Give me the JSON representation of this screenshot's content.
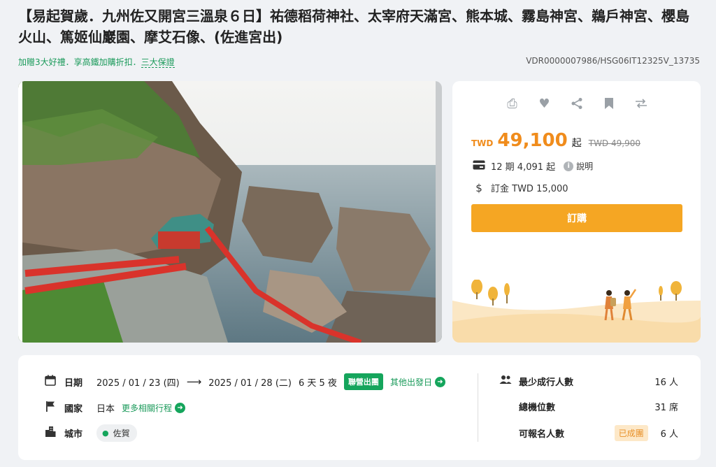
{
  "header": {
    "title": "【易起賀歲．九州佐又開宮三溫泉６日】祐德稻荷神社、太宰府天滿宮、熊本城、霧島神宮、鵜戶神宮、櫻島火山、篤姬仙巖園、摩艾石像、(佐進宮出)",
    "promo_prefix": "加贈3大好禮．享高鐵加購折扣．",
    "promo_link": "三大保證",
    "product_code": "VDR0000007986/HSG06IT12325V_13735"
  },
  "actions": {
    "icons": [
      "print-icon",
      "heart-icon",
      "share-icon",
      "bookmark-icon",
      "compare-icon"
    ]
  },
  "pricing": {
    "currency": "TWD",
    "price": "49,100",
    "qi": "起",
    "original": "TWD 49,900",
    "installment": "12 期 4,091 起",
    "explain": "說明",
    "deposit": "訂金 TWD 15,000",
    "order_button": "訂購"
  },
  "trip": {
    "date_label": "日期",
    "start_date": "2025 / 01 / 23 (四)",
    "end_date": "2025 / 01 / 28 (二)",
    "duration": "6 天 5 夜",
    "joint_tag": "聯營出團",
    "other_dates": "其他出發日",
    "country_label": "國家",
    "country": "日本",
    "related": "更多相關行程",
    "city_label": "城市",
    "city": "佐賀"
  },
  "group": {
    "min_label": "最少成行人數",
    "min_value": "16 人",
    "seats_label": "總機位數",
    "seats_value": "31 席",
    "signup_label": "可報名人數",
    "status_badge": "已成團",
    "signup_value": "6 人"
  },
  "colors": {
    "accent": "#f08c1c",
    "button": "#f5a623",
    "green": "#15a55c",
    "photo_railing": "#d9332b"
  }
}
